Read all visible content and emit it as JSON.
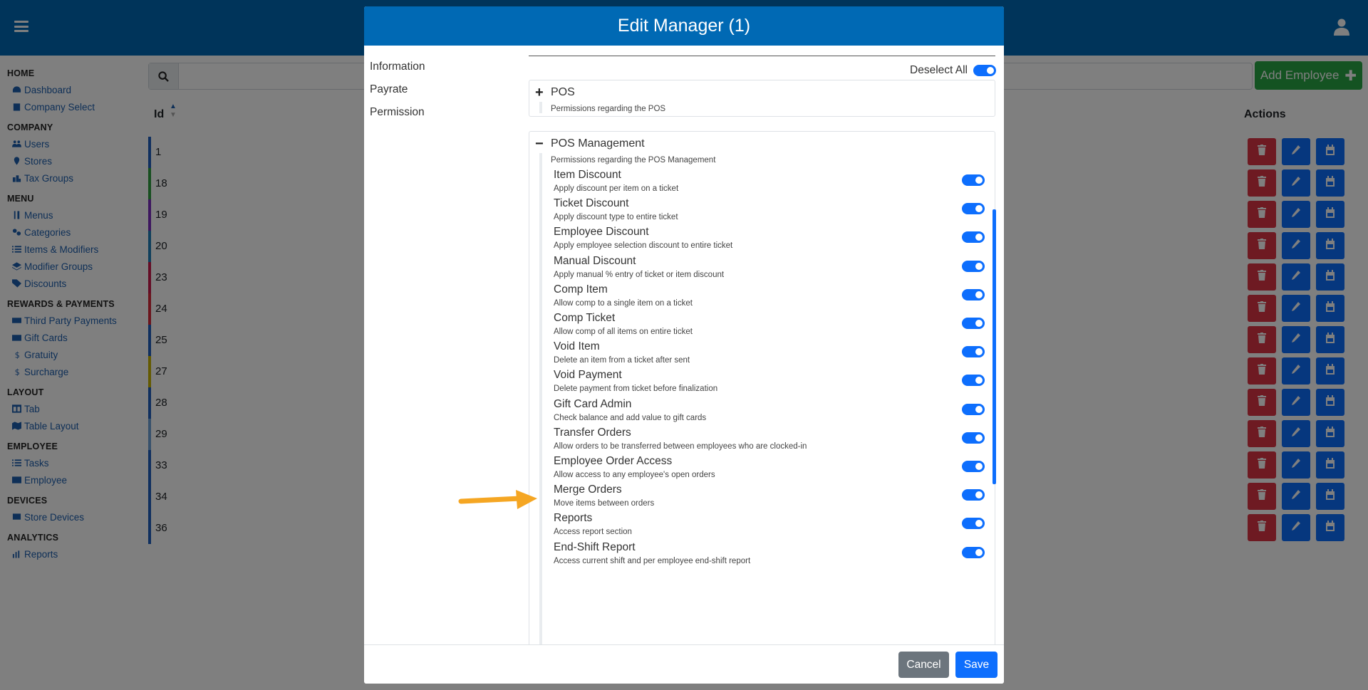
{
  "sidebar": {
    "sections": [
      {
        "title": "HOME",
        "items": [
          {
            "label": "Dashboard",
            "icon": "dashboard-icon"
          },
          {
            "label": "Company Select",
            "icon": "building-icon"
          }
        ]
      },
      {
        "title": "COMPANY",
        "items": [
          {
            "label": "Users",
            "icon": "users-icon"
          },
          {
            "label": "Stores",
            "icon": "map-marker-icon"
          },
          {
            "label": "Tax Groups",
            "icon": "tax-icon"
          }
        ]
      },
      {
        "title": "MENU",
        "items": [
          {
            "label": "Menus",
            "icon": "utensils-icon"
          },
          {
            "label": "Categories",
            "icon": "categories-icon"
          },
          {
            "label": "Items & Modifiers",
            "icon": "list-icon"
          },
          {
            "label": "Modifier Groups",
            "icon": "layers-icon"
          },
          {
            "label": "Discounts",
            "icon": "tag-icon"
          }
        ]
      },
      {
        "title": "REWARDS & PAYMENTS",
        "items": [
          {
            "label": "Third Party Payments",
            "icon": "money-icon"
          },
          {
            "label": "Gift Cards",
            "icon": "gift-card-icon"
          },
          {
            "label": "Gratuity",
            "icon": "dollar-icon"
          },
          {
            "label": "Surcharge",
            "icon": "dollar-icon"
          }
        ]
      },
      {
        "title": "LAYOUT",
        "items": [
          {
            "label": "Tab",
            "icon": "table-icon"
          },
          {
            "label": "Table Layout",
            "icon": "map-icon"
          }
        ]
      },
      {
        "title": "EMPLOYEE",
        "items": [
          {
            "label": "Tasks",
            "icon": "list-icon"
          },
          {
            "label": "Employee",
            "icon": "id-card-icon"
          }
        ]
      },
      {
        "title": "DEVICES",
        "items": [
          {
            "label": "Store Devices",
            "icon": "devices-icon"
          }
        ]
      },
      {
        "title": "ANALYTICS",
        "items": [
          {
            "label": "Reports",
            "icon": "chart-icon"
          }
        ]
      }
    ]
  },
  "main": {
    "add_button": "Add Employee",
    "col_id": "Id",
    "col_actions": "Actions",
    "rows": [
      {
        "id": "1",
        "color": "#1f5fbf"
      },
      {
        "id": "18",
        "color": "#2e9e3e"
      },
      {
        "id": "19",
        "color": "#7b2cbf"
      },
      {
        "id": "20",
        "color": "#1e7fb8"
      },
      {
        "id": "23",
        "color": "#c9184a"
      },
      {
        "id": "24",
        "color": "#d62839"
      },
      {
        "id": "25",
        "color": "#1f5fbf"
      },
      {
        "id": "27",
        "color": "#c8b400"
      },
      {
        "id": "28",
        "color": "#1f5fbf"
      },
      {
        "id": "29",
        "color": "#6fa3d8"
      },
      {
        "id": "33",
        "color": "#1f5fbf"
      },
      {
        "id": "34",
        "color": "#1f5fbf"
      },
      {
        "id": "36",
        "color": "#1f5fbf"
      }
    ]
  },
  "modal": {
    "title": "Edit Manager (1)",
    "nav": [
      "Information",
      "Payrate",
      "Permission"
    ],
    "deselect_all": "Deselect All",
    "groups": [
      {
        "sign": "+",
        "title": "POS",
        "desc": "Permissions regarding the POS"
      },
      {
        "sign": "−",
        "title": "POS Management",
        "desc": "Permissions regarding the POS Management"
      }
    ],
    "permissions": [
      {
        "title": "Item Discount",
        "desc": "Apply discount per item on a ticket"
      },
      {
        "title": "Ticket Discount",
        "desc": "Apply discount type to entire ticket"
      },
      {
        "title": "Employee Discount",
        "desc": "Apply employee selection discount to entire ticket"
      },
      {
        "title": "Manual Discount",
        "desc": "Apply manual % entry of ticket or item discount"
      },
      {
        "title": "Comp Item",
        "desc": "Allow comp to a single item on a ticket"
      },
      {
        "title": "Comp Ticket",
        "desc": "Allow comp of all items on entire ticket"
      },
      {
        "title": "Void Item",
        "desc": "Delete an item from a ticket after sent"
      },
      {
        "title": "Void Payment",
        "desc": "Delete payment from ticket before finalization"
      },
      {
        "title": "Gift Card Admin",
        "desc": "Check balance and add value to gift cards"
      },
      {
        "title": "Transfer Orders",
        "desc": "Allow orders to be transferred between employees who are clocked-in"
      },
      {
        "title": "Employee Order Access",
        "desc": "Allow access to any employee's open orders"
      },
      {
        "title": "Merge Orders",
        "desc": "Move items between orders"
      },
      {
        "title": "Reports",
        "desc": "Access report section"
      },
      {
        "title": "End-Shift Report",
        "desc": "Access current shift and per employee end-shift report"
      }
    ],
    "cancel": "Cancel",
    "save": "Save"
  },
  "colors": {
    "header_blue": "#0069b4",
    "toggle_on": "#0d6efd",
    "add_green": "#28a745",
    "arrow": "#f5a623"
  }
}
